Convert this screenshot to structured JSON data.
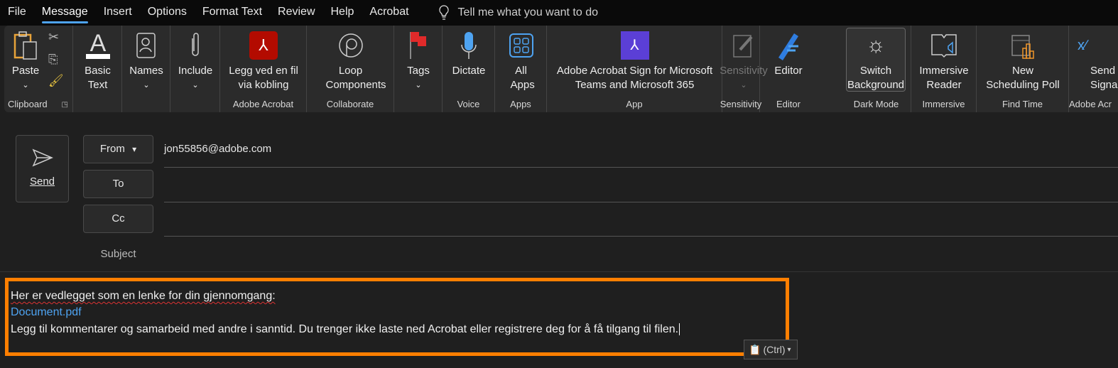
{
  "menu": {
    "items": [
      "File",
      "Message",
      "Insert",
      "Options",
      "Format Text",
      "Review",
      "Help",
      "Acrobat"
    ],
    "active": "Message",
    "tell_me": "Tell me what you want to do"
  },
  "ribbon": {
    "clipboard": {
      "paste": "Paste",
      "label": "Clipboard"
    },
    "basic_text": {
      "label": "Basic Text"
    },
    "names": {
      "label": "Names"
    },
    "include": {
      "label": "Include"
    },
    "acrobat": {
      "button": "Legg ved en fil via kobling",
      "label": "Adobe Acrobat"
    },
    "collaborate": {
      "button": "Loop Components",
      "label": "Collaborate"
    },
    "tags": {
      "label": "Tags"
    },
    "voice": {
      "button": "Dictate",
      "label": "Voice"
    },
    "apps": {
      "button": "All Apps",
      "label": "Apps"
    },
    "app": {
      "button1": "Adobe Acrobat Sign for Microsoft",
      "button2": "Teams and Microsoft 365",
      "label": "App"
    },
    "sensitivity": {
      "button": "Sensitivity",
      "label": "Sensitivity"
    },
    "editor": {
      "button": "Editor",
      "label": "Editor"
    },
    "dark_mode": {
      "button1": "Switch",
      "button2": "Background",
      "label": "Dark Mode"
    },
    "immersive": {
      "button1": "Immersive",
      "button2": "Reader",
      "label": "Immersive"
    },
    "find_time": {
      "button1": "New",
      "button2": "Scheduling Poll",
      "label": "Find Time"
    },
    "acrobat_sign": {
      "button1": "Send",
      "button2": "Signa",
      "label": "Adobe Acr"
    }
  },
  "compose": {
    "send": "Send",
    "from": "From",
    "to": "To",
    "cc": "Cc",
    "subject": "Subject",
    "from_value": "jon55856@adobe.com"
  },
  "body": {
    "line1": "Her er vedlegget som en lenke for din gjennomgang:",
    "link": "Document.pdf",
    "line3": "Legg til kommentarer og samarbeid med andre i sanntid. Du trenger ikke laste ned Acrobat eller registrere deg for å få tilgang til filen.",
    "paste_ctrl": "(Ctrl)"
  },
  "colors": {
    "highlight": "#ff7f00",
    "accent": "#4ea3f1"
  }
}
